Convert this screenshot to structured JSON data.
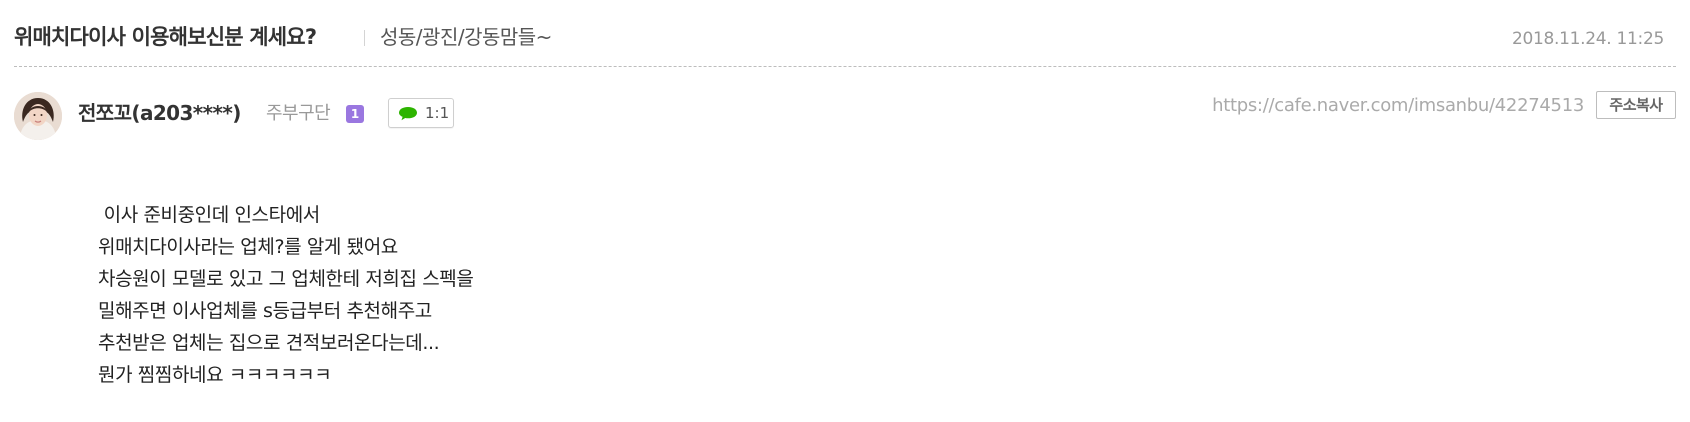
{
  "post": {
    "title": "위매치다이사 이용해보신분 계세요?",
    "board": "성동/광진/강동맘들~",
    "date": "2018.11.24. 11:25"
  },
  "author": {
    "nickname": "전쪼꼬(a203****)",
    "grade": "주부구단",
    "level": "1",
    "chat_label": "1:1",
    "avatar_icon": "avatar-photo"
  },
  "share": {
    "url": "https://cafe.naver.com/imsanbu/42274513",
    "copy_label": "주소복사"
  },
  "body": {
    "lines": [
      " 이사 준비중인데 인스타에서",
      "위매치다이사라는 업체?를 알게 됐어요",
      "차승원이 모델로 있고 그 업체한테 저희집 스펙을",
      "밀해주면 이사업체를 s등급부터 추천해주고",
      "추천받은 업체는 집으로 견적보러온다는데...",
      "뭔가 찜찜하네요 ㅋㅋㅋㅋㅋㅋ"
    ]
  },
  "colors": {
    "level_badge": "#9a77e0",
    "chat_bubble": "#2db400"
  }
}
